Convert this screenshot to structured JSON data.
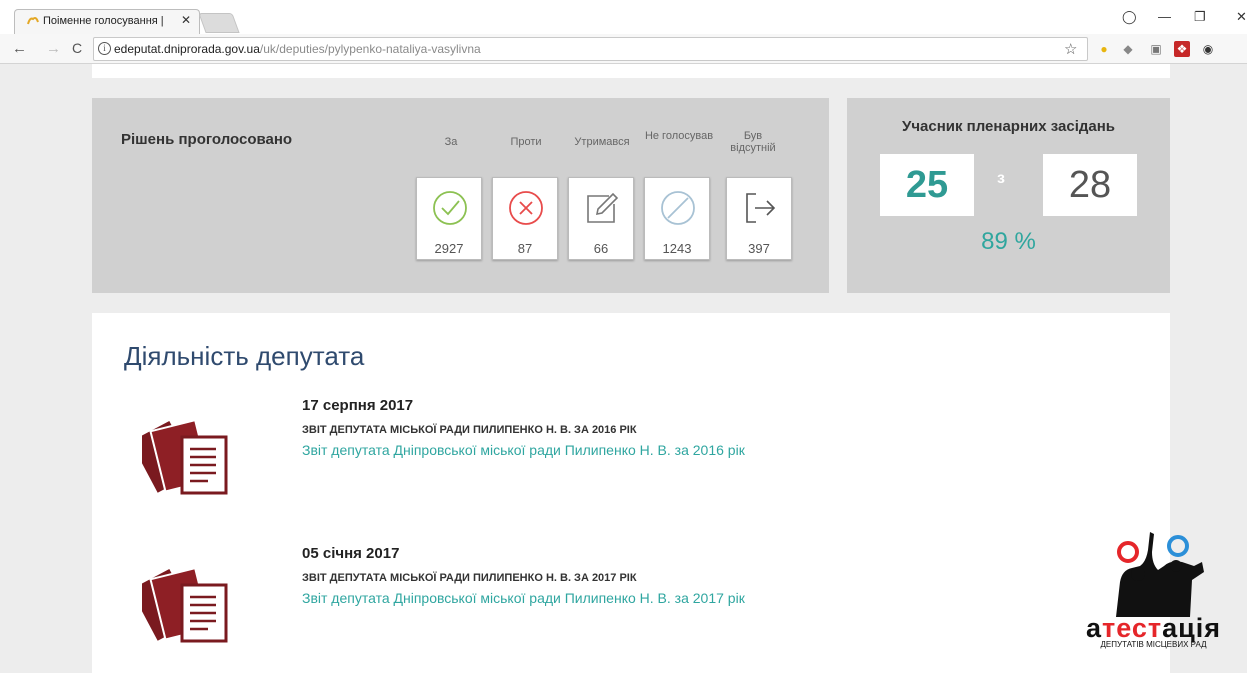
{
  "browser": {
    "tab_title": "Поіменне голосування |",
    "tab_close": "✕",
    "url_host": "edeputat.dniprorada.gov.ua",
    "url_path": "/uk/deputies/pylypenko-nataliya-vasylivna",
    "window_controls": [
      "minimize",
      "maximize",
      "close"
    ]
  },
  "votes": {
    "title": "Рішень проголосовано",
    "columns": [
      {
        "label": "За",
        "count": "2927",
        "icon": "check-circle-icon",
        "color": "#8cc152"
      },
      {
        "label": "Проти",
        "count": "87",
        "icon": "cross-circle-icon",
        "color": "#e84b4b"
      },
      {
        "label": "Утримався",
        "count": "66",
        "icon": "edit-icon",
        "color": "#777777"
      },
      {
        "label": "Не голосував",
        "count": "1243",
        "icon": "blocked-circle-icon",
        "color": "#a8c2d4"
      },
      {
        "label": "Був відсутній",
        "count": "397",
        "icon": "exit-icon",
        "color": "#555555"
      }
    ]
  },
  "plenary": {
    "title": "Учасник пленарних засідань",
    "attended": "25",
    "of": "з",
    "total": "28",
    "percent": "89 %",
    "accent": "#2fa69e"
  },
  "activity": {
    "title": "Діяльність депутата",
    "entries": [
      {
        "date": "17 серпня 2017",
        "heading": "ЗВІТ ДЕПУТАТА МІСЬКОЇ РАДИ ПИЛИПЕНКО Н. В. ЗА 2016 РІК",
        "link": "Звіт депутата Дніпровської міської ради Пилипенко Н. В. за 2016 рік"
      },
      {
        "date": "05 січня 2017",
        "heading": "ЗВІТ ДЕПУТАТА МІСЬКОЇ РАДИ ПИЛИПЕНКО Н. В. ЗА 2017 РІК",
        "link": "Звіт депутата Дніпровської міської ради Пилипенко Н. В. за 2017 рік"
      }
    ]
  },
  "watermark": {
    "text_a": "а",
    "text_red": "тест",
    "text_b": "ація",
    "subtitle": "ДЕПУТАТІВ МІСЦЕВИХ РАД"
  }
}
